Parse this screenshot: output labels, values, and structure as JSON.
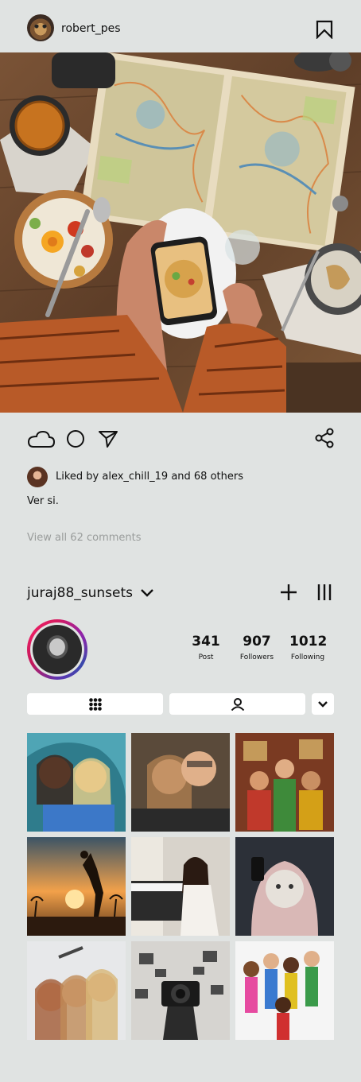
{
  "post": {
    "username": "robert_pes",
    "likes_text": "Liked by alex_chill_19 and 68 others",
    "caption": "Ver si.",
    "view_comments": "View all 62 comments"
  },
  "profile": {
    "name": "juraj88_sunsets",
    "stats": [
      {
        "value": "341",
        "label": "Post"
      },
      {
        "value": "907",
        "label": "Followers"
      },
      {
        "value": "1012",
        "label": "Following"
      }
    ]
  },
  "grid_items": [
    "two-girls-laughing-photo",
    "couple-selfie-photo",
    "costume-group-photo",
    "volleyball-sunset-photo",
    "girl-piano-photo",
    "face-mask-selfie-photo",
    "friends-group-selfie-photo",
    "photographer-camera-photo",
    "cartoon-characters-photo"
  ],
  "colors": {
    "background": "#e0e3e2",
    "text": "#111111",
    "muted": "#9a9d9c",
    "ring_start": "#d81b60",
    "ring_end": "#3949ab"
  }
}
